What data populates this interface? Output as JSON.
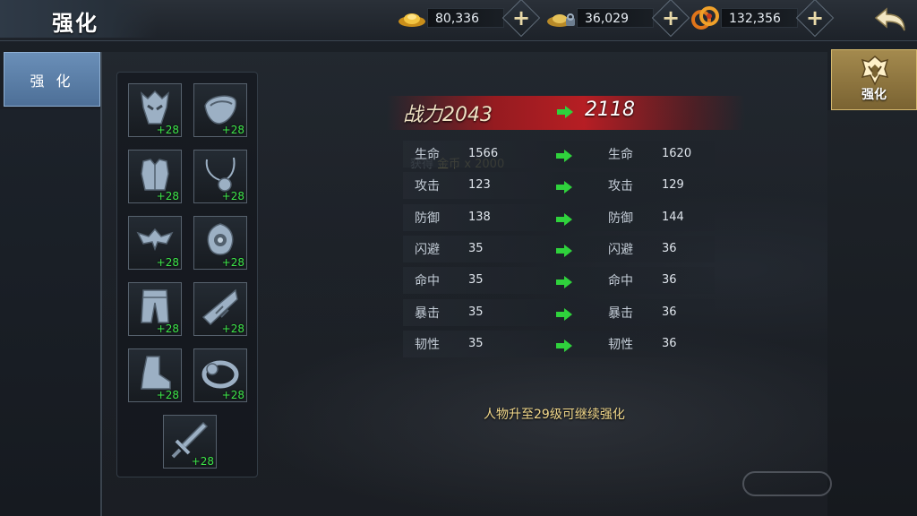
{
  "header": {
    "title": "强化"
  },
  "currencies": [
    {
      "name": "gold-ingot-icon",
      "value": "80,336"
    },
    {
      "name": "bound-ingot-icon",
      "value": "36,029"
    },
    {
      "name": "coins-icon",
      "value": "132,356"
    }
  ],
  "left_tab": {
    "label": "强 化"
  },
  "right_tab": {
    "label": "强化",
    "icon": "helmet-crest-icon"
  },
  "equipment": [
    {
      "name": "helmet",
      "level": "+28"
    },
    {
      "name": "shoulder",
      "level": "+28"
    },
    {
      "name": "armor",
      "level": "+28"
    },
    {
      "name": "necklace",
      "level": "+28"
    },
    {
      "name": "belt",
      "level": "+28"
    },
    {
      "name": "amulet",
      "level": "+28"
    },
    {
      "name": "leggings",
      "level": "+28"
    },
    {
      "name": "bracer",
      "level": "+28"
    },
    {
      "name": "boots",
      "level": "+28"
    },
    {
      "name": "ring",
      "level": "+28"
    },
    {
      "name": "weapon",
      "level": "+28"
    }
  ],
  "power": {
    "label": "战力",
    "old": "2043",
    "new": "2118"
  },
  "stats": [
    {
      "name": "生命",
      "old": "1566",
      "new": "1620"
    },
    {
      "name": "攻击",
      "old": "123",
      "new": "129"
    },
    {
      "name": "防御",
      "old": "138",
      "new": "144"
    },
    {
      "name": "闪避",
      "old": "35",
      "new": "36"
    },
    {
      "name": "命中",
      "old": "35",
      "new": "36"
    },
    {
      "name": "暴击",
      "old": "35",
      "new": "36"
    },
    {
      "name": "韧性",
      "old": "35",
      "new": "36"
    }
  ],
  "ghost": {
    "prefix": "获得",
    "item": "金币",
    "amount": "x 2000"
  },
  "notice": "人物升至29级可继续强化",
  "colors": {
    "accent_red": "#b41e23",
    "level_green": "#3ee64a",
    "arrow_green": "#2fd23c",
    "notice_gold": "#f2d88a",
    "tab_blue": "#5a7fa8",
    "tab_gold": "#8c7440"
  }
}
